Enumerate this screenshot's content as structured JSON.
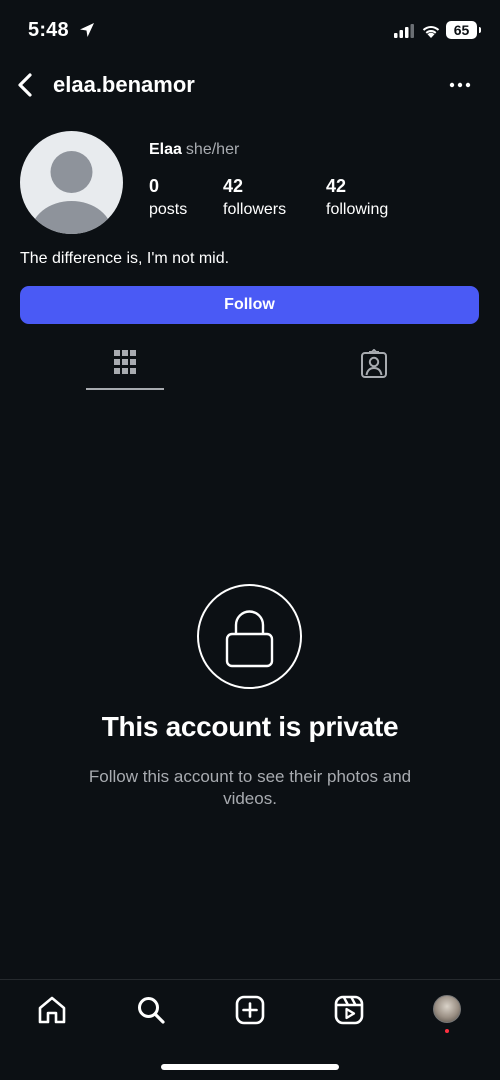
{
  "status_bar": {
    "time": "5:48",
    "battery": "65"
  },
  "header": {
    "username": "elaa.benamor",
    "back_icon": "chevron-left-icon",
    "more_icon": "more-horizontal-icon"
  },
  "profile": {
    "display_name": "Elaa",
    "pronouns": "she/her",
    "stats": [
      {
        "value": "0",
        "label": "posts"
      },
      {
        "value": "42",
        "label": "followers"
      },
      {
        "value": "42",
        "label": "following"
      }
    ],
    "bio": "The difference is, I'm not mid.",
    "follow_label": "Follow"
  },
  "tabs": [
    {
      "icon": "grid-icon",
      "active": true
    },
    {
      "icon": "tagged-icon",
      "active": false
    }
  ],
  "private": {
    "title": "This account is private",
    "subtitle": "Follow this account to see their photos and videos."
  },
  "bottom_nav": [
    {
      "icon": "home-icon"
    },
    {
      "icon": "search-icon"
    },
    {
      "icon": "create-icon"
    },
    {
      "icon": "reels-icon"
    },
    {
      "icon": "profile-avatar"
    }
  ],
  "colors": {
    "background": "#0c1014",
    "accent": "#4a5af5",
    "muted_text": "#a8abb0",
    "notification_dot": "#ff3040"
  }
}
